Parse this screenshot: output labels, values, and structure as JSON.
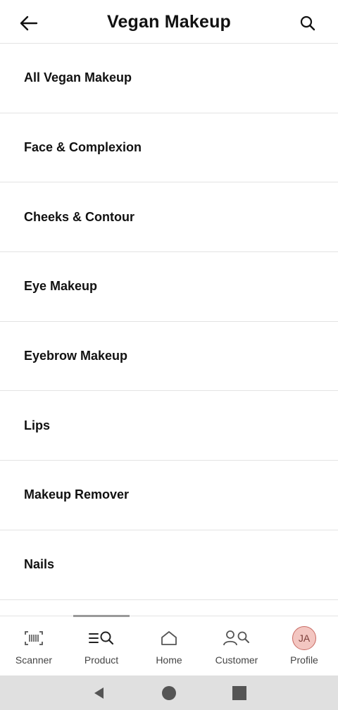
{
  "header": {
    "title": "Vegan Makeup",
    "back_icon": "back-arrow-icon",
    "search_icon": "search-icon"
  },
  "categories": [
    {
      "label": "All Vegan Makeup"
    },
    {
      "label": "Face & Complexion"
    },
    {
      "label": "Cheeks & Contour"
    },
    {
      "label": "Eye Makeup"
    },
    {
      "label": "Eyebrow Makeup"
    },
    {
      "label": "Lips"
    },
    {
      "label": "Makeup Remover"
    },
    {
      "label": "Nails"
    }
  ],
  "bottom_nav": {
    "active": "Product",
    "items": [
      {
        "label": "Scanner",
        "icon": "barcode-scanner-icon"
      },
      {
        "label": "Product",
        "icon": "product-search-icon"
      },
      {
        "label": "Home",
        "icon": "home-icon"
      },
      {
        "label": "Customer",
        "icon": "customer-search-icon"
      },
      {
        "label": "Profile",
        "icon": "avatar",
        "initials": "JA"
      }
    ]
  },
  "colors": {
    "avatar_bg": "#f3c6c1",
    "avatar_border": "#c86a63",
    "divider": "#e3e3e3"
  }
}
